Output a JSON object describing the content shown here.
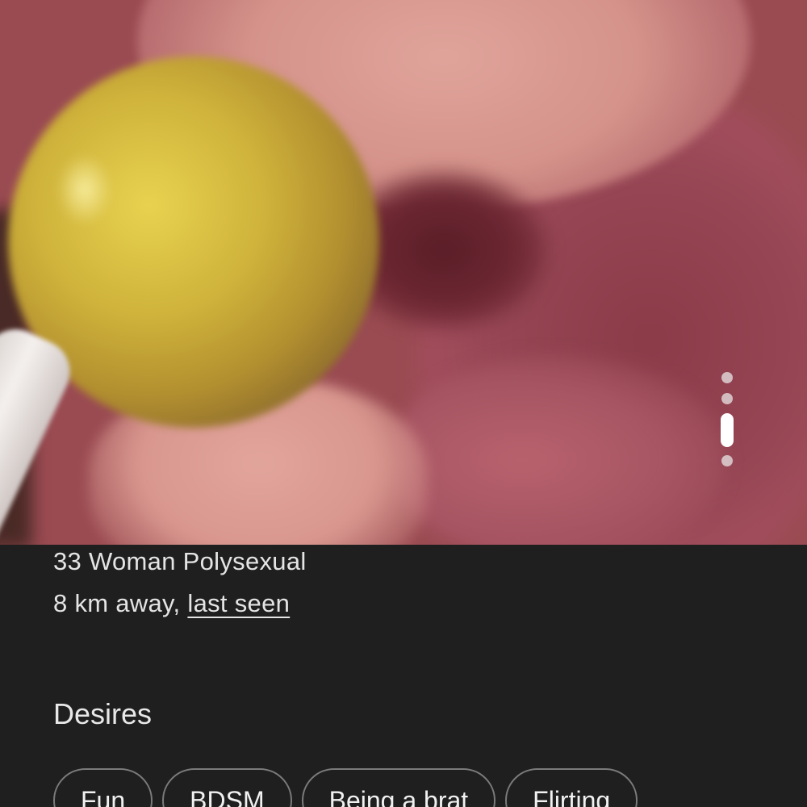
{
  "profile": {
    "photo_description_icon": "profile-photo",
    "carousel": {
      "total": 4,
      "active_index": 2
    },
    "summary_line": "33 Woman Polysexual",
    "distance_text": "8 km away,",
    "last_seen_link": "last seen"
  },
  "desires": {
    "title": "Desires",
    "chips": [
      "Fun",
      "BDSM",
      "Being a brat",
      "Flirting"
    ]
  }
}
